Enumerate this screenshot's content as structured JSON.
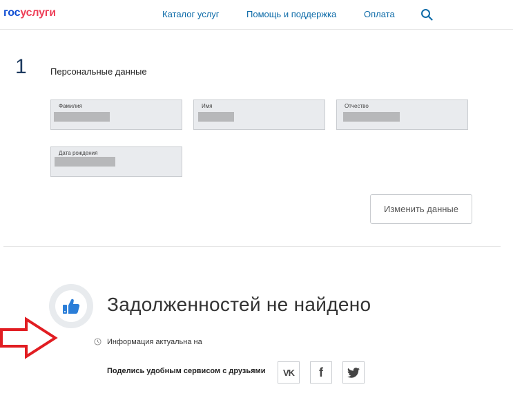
{
  "header": {
    "logo_part1": "гос",
    "logo_part2": "услуги",
    "nav": [
      "Каталог услуг",
      "Помощь и поддержка",
      "Оплата"
    ],
    "search_icon": "search-icon"
  },
  "personal": {
    "step": "1",
    "title": "Персональные данные",
    "fields": {
      "last_name": "Фамилия",
      "first_name": "Имя",
      "patronymic": "Отчество",
      "birth_date": "Дата рождения"
    },
    "change_button": "Изменить данные"
  },
  "result": {
    "icon": "thumbs-up-icon",
    "title": "Задолженностей не найдено",
    "info_icon": "clock-icon",
    "info_text": "Информация актуальна на"
  },
  "share": {
    "text": "Поделись удобным сервисом с друзьями",
    "vk": "vk",
    "facebook": "f"
  },
  "colors": {
    "brand_blue": "#0d4cd3",
    "brand_red": "#ee3f58",
    "link": "#0d6ba8",
    "thumb": "#2b7ed8",
    "arrow": "#e11d22"
  }
}
